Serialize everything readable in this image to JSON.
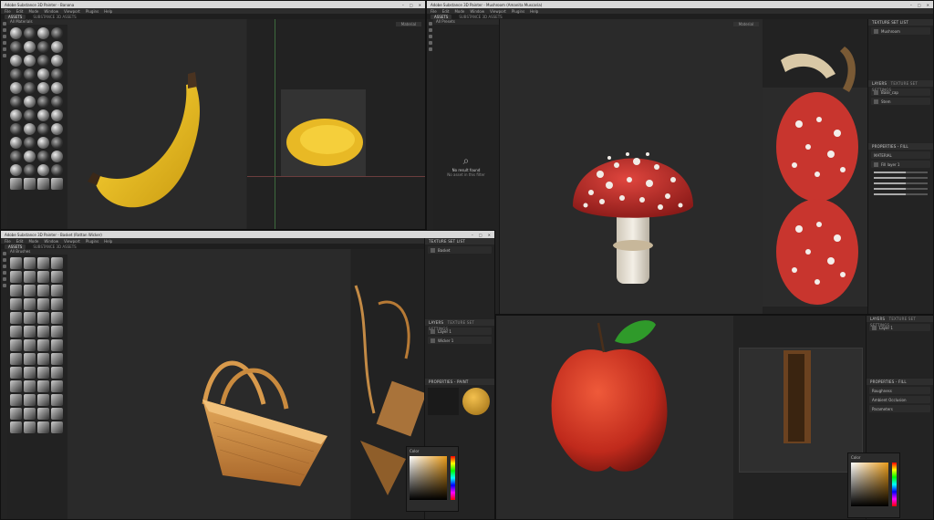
{
  "windows": {
    "tl": {
      "title": "Adobe Substance 3D Painter - Banana",
      "menu": [
        "File",
        "Edit",
        "Mode",
        "Window",
        "Viewport",
        "Plugins",
        "Help"
      ],
      "tabs": [
        "ASSETS",
        "SUBSTANCE 3D ASSETS"
      ],
      "shelf_title": "All Materials",
      "viewport_mode": "Material"
    },
    "tr": {
      "title": "Adobe Substance 3D Painter - Mushroom (Amanita Muscaria)",
      "menu": [
        "File",
        "Edit",
        "Mode",
        "Window",
        "Viewport",
        "Plugins",
        "Help"
      ],
      "tabs": [
        "ASSETS",
        "SUBSTANCE 3D ASSETS"
      ],
      "shelf_title": "All Presets",
      "no_result_title": "No result found",
      "no_result_sub": "No asset in this filter",
      "viewport_mode": "Material",
      "panels": {
        "texture_set": "TEXTURE SET LIST",
        "layers": "LAYERS",
        "layers_tab2": "TEXTURE SET SETTINGS",
        "properties": "PROPERTIES - FILL",
        "materials": "MATERIAL",
        "layer1": "Base_cap",
        "layer2": "Stem",
        "fill_name": "Fill layer 1"
      }
    },
    "bl": {
      "title": "Adobe Substance 3D Painter - Basket (Rattan Wicker)",
      "menu": [
        "File",
        "Edit",
        "Mode",
        "Window",
        "Viewport",
        "Plugins",
        "Help"
      ],
      "tabs": [
        "ASSETS",
        "SUBSTANCE 3D ASSETS"
      ],
      "shelf_title": "All Brushes",
      "panels": {
        "texture_set": "TEXTURE SET LIST",
        "layers": "LAYERS",
        "layers_tab2": "TEXTURE SET SETTINGS",
        "properties": "PROPERTIES - PAINT",
        "layer1": "Layer 1",
        "layer2": "Wicker 1",
        "color_title": "Color"
      }
    },
    "br": {
      "panels": {
        "layers": "LAYERS",
        "layers_tab2": "TEXTURE SET SETTINGS",
        "properties": "PROPERTIES - FILL",
        "layer1": "Layer 1",
        "prop1": "Roughness",
        "prop2": "Ambient Occlusion",
        "prop3": "Parameters",
        "color_title": "Color"
      }
    }
  },
  "icons": [
    "search-icon",
    "minimize-icon",
    "maximize-icon",
    "close-icon",
    "eye-icon",
    "folder-icon"
  ],
  "colors": {
    "accent": "#e89b1a",
    "panel": "#232323",
    "viewport": "#2a2a2a"
  }
}
